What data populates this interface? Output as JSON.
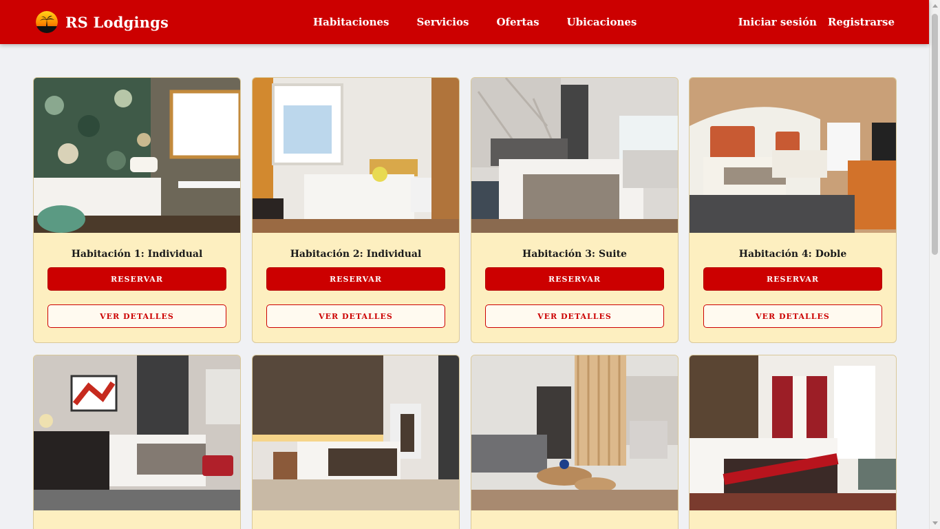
{
  "brand": {
    "name": "RS Lodgings",
    "logo_icon": "sunset-palm-logo-icon"
  },
  "nav": {
    "links": [
      "Habitaciones",
      "Servicios",
      "Ofertas",
      "Ubicaciones"
    ]
  },
  "auth": {
    "login": "Iniciar sesión",
    "register": "Registrarse"
  },
  "buttons": {
    "reserve": "RESERVAR",
    "details": "VER DETALLES"
  },
  "rooms": [
    {
      "title": "Habitación 1: Individual",
      "photo": "hotel-room-photo"
    },
    {
      "title": "Habitación 2: Individual",
      "photo": "hotel-room-photo"
    },
    {
      "title": "Habitación 3: Suite",
      "photo": "hotel-room-photo"
    },
    {
      "title": "Habitación 4: Doble",
      "photo": "hotel-room-photo"
    },
    {
      "title": "",
      "photo": "hotel-room-photo"
    },
    {
      "title": "",
      "photo": "hotel-room-photo"
    },
    {
      "title": "",
      "photo": "hotel-room-photo"
    },
    {
      "title": "",
      "photo": "hotel-room-photo"
    }
  ],
  "colors": {
    "primary": "#cc0000",
    "card_bg": "#fdefc0",
    "page_bg": "#f0f1f4"
  }
}
